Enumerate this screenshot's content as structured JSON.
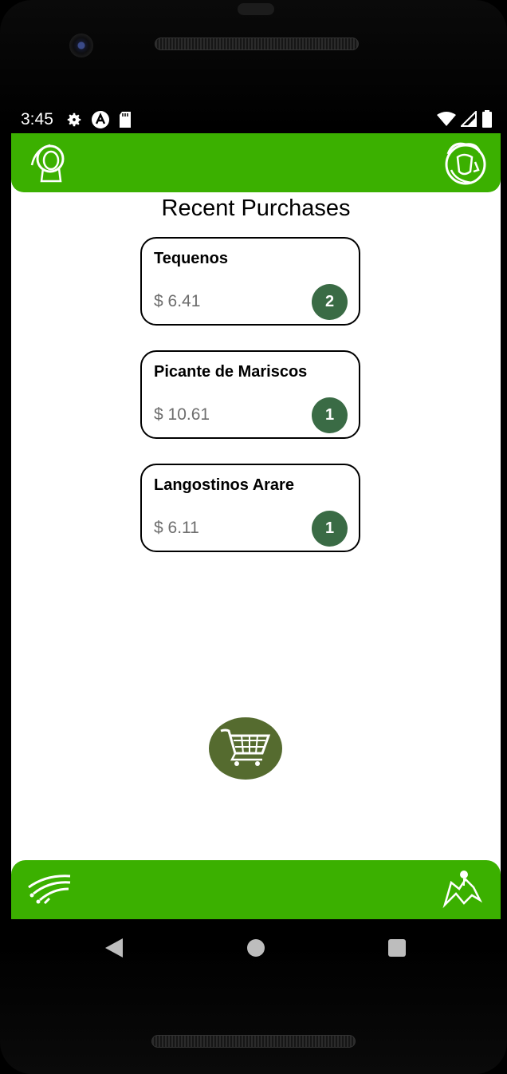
{
  "status_bar": {
    "time": "3:45",
    "left_icons": [
      "settings-icon",
      "a-logo-icon",
      "sd-card-icon"
    ],
    "right_icons": [
      "wifi-icon",
      "signal-icon",
      "battery-icon"
    ]
  },
  "header": {
    "left_icon": "profile-icon",
    "right_icon": "chef-logo-icon",
    "bar_color": "#3bb000"
  },
  "page": {
    "title": "Recent Purchases"
  },
  "purchases": [
    {
      "name": "Tequenos",
      "price": "$ 6.41",
      "quantity": "2"
    },
    {
      "name": "Picante de Mariscos",
      "price": "$ 10.61",
      "quantity": "1"
    },
    {
      "name": "Langostinos Arare",
      "price": "$ 6.11",
      "quantity": "1"
    }
  ],
  "bottom_nav": {
    "left_icon": "wifi-menu-icon",
    "center_icon": "shopping-cart-icon",
    "right_icon": "map-pin-icon",
    "fab_color": "#556b2f",
    "badge_color": "#3a6b45"
  },
  "system_nav": [
    "back-icon",
    "home-icon",
    "recents-icon"
  ]
}
